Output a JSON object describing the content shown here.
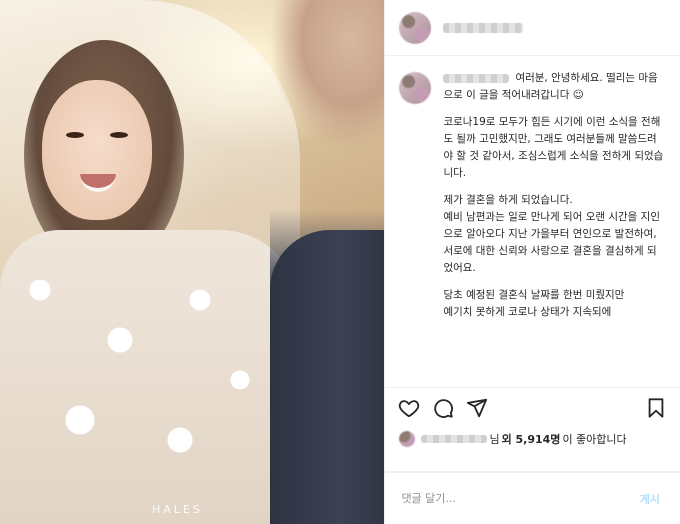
{
  "photo": {
    "watermark": "HALES"
  },
  "caption": {
    "first_line": "여러분, 안녕하세요. 떨리는 마음으로 이 글을 적어내려갑니다 ☺",
    "paragraphs": [
      "코로나19로 모두가 힘든 시기에 이런 소식을 전해도 될까 고민했지만, 그래도 여러분들께 말씀드려야 할 것 같아서, 조심스럽게 소식을 전하게 되었습니다.",
      "제가 결혼을 하게 되었습니다.\n예비 남편과는 일로 만나게 되어 오랜 시간을 지인으로 알아오다 지난 가을부터 연인으로 발전하여,\n서로에 대한 신뢰와 사랑으로 결혼을 결심하게 되었어요.",
      "당초 예정된 결혼식 날짜를 한번 미뤘지만\n예기치 못하게 코로나 상태가 지속되에"
    ]
  },
  "actions": {
    "like_icon": "heart-icon",
    "comment_icon": "comment-icon",
    "share_icon": "paper-plane-icon",
    "save_icon": "bookmark-icon"
  },
  "likes": {
    "suffix_before": "님",
    "count_text": "외 5,914명",
    "suffix_after": "이 좋아합니다"
  },
  "comment": {
    "placeholder": "댓글 달기...",
    "post_label": "게시"
  },
  "colors": {
    "text": "#262626",
    "muted": "#8e8e8e",
    "post_button": "#b2dffc",
    "border": "#efefef"
  }
}
